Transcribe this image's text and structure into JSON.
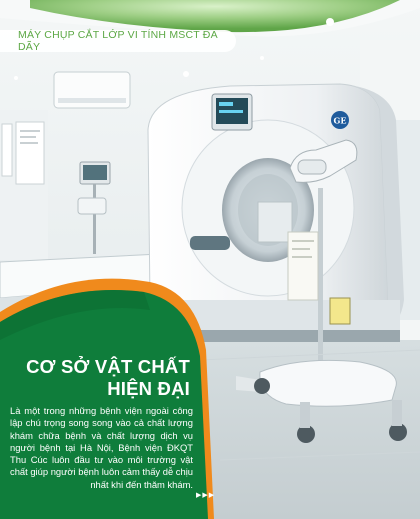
{
  "header": {
    "label": "MÁY CHỤP CẮT LỚP VI TÍNH MSCT ĐA DÃY"
  },
  "machine": {
    "brand_logo": "GE"
  },
  "feature": {
    "title_line1": "CƠ SỞ VẬT CHẤT",
    "title_line2": "HIỆN ĐẠI",
    "description": "Là một trong những bệnh viện ngoài công lập chú trọng song song vào cả chất lượng khám chữa bệnh và chất lượng dịch vụ người bệnh tại Hà Nội, Bệnh viện ĐKQT Thu Cúc luôn đầu tư vào môi trường vật chất giúp người bệnh luôn cảm thấy dễ chịu nhất khi đến thăm khám.",
    "more_icon": "triple-arrow-right-icon"
  },
  "colors": {
    "brand_green": "#0f7d3b",
    "accent_orange": "#f08a1c",
    "label_green": "#5ca845"
  }
}
